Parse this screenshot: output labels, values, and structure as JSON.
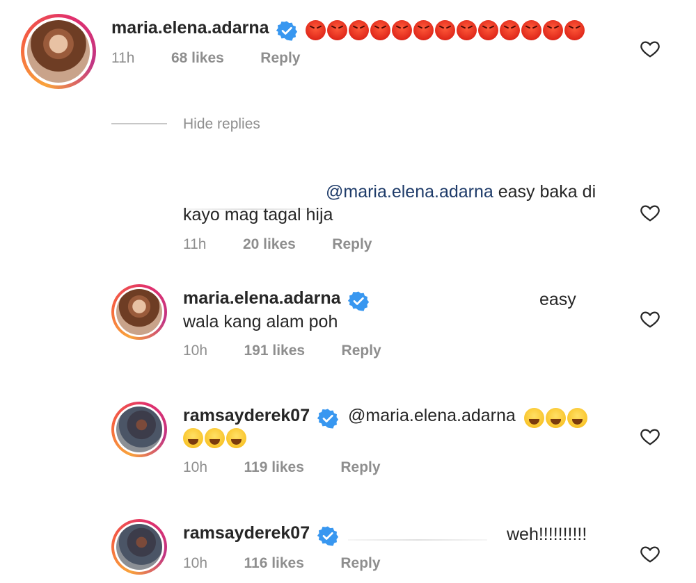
{
  "comment": {
    "username": "maria.elena.adarna",
    "verified": true,
    "emoji_text": "😡😡😡😡😡😡😡😡😡😡😡😡😡",
    "time": "11h",
    "likes": "68 likes",
    "reply_label": "Reply"
  },
  "hide_replies_label": "Hide replies",
  "replies": [
    {
      "username": "",
      "mention": "@maria.elena.adarna",
      "text_line1": "easy baka di",
      "text_line2": "kayo mag tagal hija",
      "time": "11h",
      "likes": "20 likes",
      "reply_label": "Reply"
    },
    {
      "username": "maria.elena.adarna",
      "verified": true,
      "text_line1": "easy",
      "text_line2": "wala kang alam poh",
      "time": "10h",
      "likes": "191 likes",
      "reply_label": "Reply"
    },
    {
      "username": "ramsayderek07",
      "verified": true,
      "mention": "@maria.elena.adarna",
      "emoji_line1": "😂😂😂",
      "emoji_line2": "😂😂😂",
      "time": "10h",
      "likes": "119 likes",
      "reply_label": "Reply"
    },
    {
      "username": "ramsayderek07",
      "verified": true,
      "text_line1": "weh!!!!!!!!!!",
      "time": "10h",
      "likes": "116 likes",
      "reply_label": "Reply"
    }
  ],
  "colors": {
    "mention": "#1e3b69",
    "meta": "#8e8e8e",
    "verified": "#3897f0",
    "angry_emoji": "#e0291b",
    "laugh_emoji": "#f9c42a"
  },
  "icons": {
    "like": "heart-icon",
    "verified": "verified-badge-icon"
  }
}
